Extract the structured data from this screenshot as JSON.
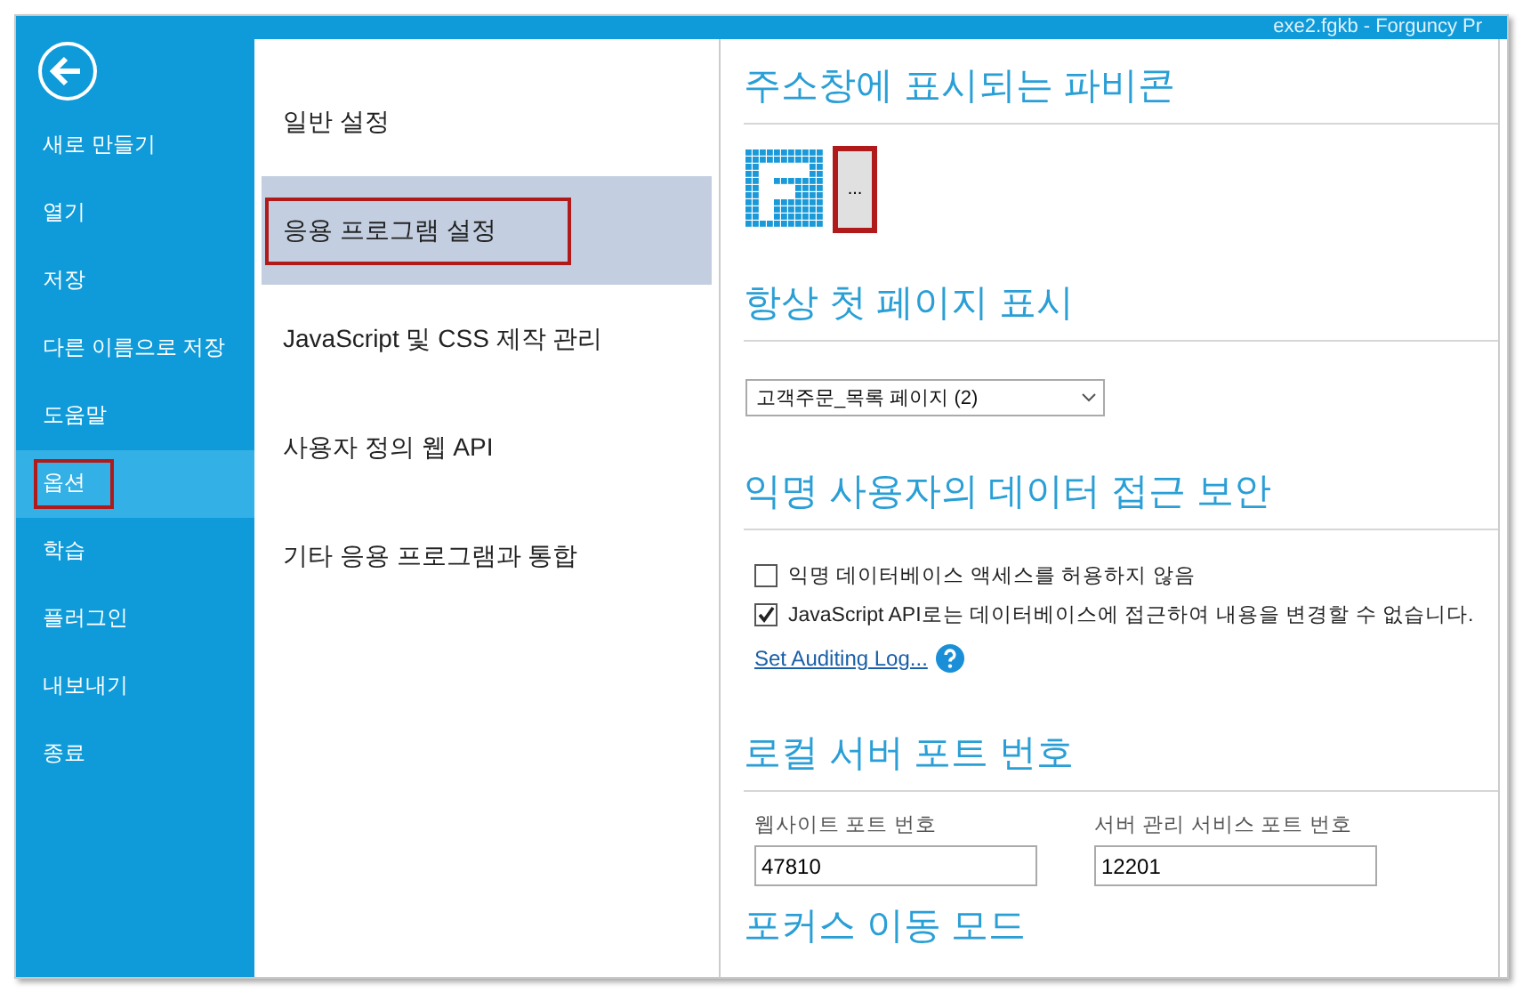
{
  "window": {
    "title": "exe2.fgkb - Forguncy Pr"
  },
  "sidebar": {
    "items": [
      {
        "label": "새로 만들기",
        "selected": false,
        "highlighted": false
      },
      {
        "label": "열기",
        "selected": false,
        "highlighted": false
      },
      {
        "label": "저장",
        "selected": false,
        "highlighted": false
      },
      {
        "label": "다른 이름으로 저장",
        "selected": false,
        "highlighted": false
      },
      {
        "label": "도움말",
        "selected": false,
        "highlighted": false
      },
      {
        "label": "옵션",
        "selected": true,
        "highlighted": true
      },
      {
        "label": "학습",
        "selected": false,
        "highlighted": false
      },
      {
        "label": "플러그인",
        "selected": false,
        "highlighted": false
      },
      {
        "label": "내보내기",
        "selected": false,
        "highlighted": false
      },
      {
        "label": "종료",
        "selected": false,
        "highlighted": false
      }
    ]
  },
  "categories": [
    {
      "label": "일반 설정",
      "selected": false,
      "highlighted": false
    },
    {
      "label": "응용 프로그램 설정",
      "selected": true,
      "highlighted": true
    },
    {
      "label": "JavaScript 및 CSS 제작 관리",
      "selected": false,
      "highlighted": false
    },
    {
      "label": "사용자 정의 웹 API",
      "selected": false,
      "highlighted": false
    },
    {
      "label": "기타 응용 프로그램과 통합",
      "selected": false,
      "highlighted": false
    }
  ],
  "sections": [
    {
      "kind": "favicon",
      "heading": "주소창에 표시되는 파비콘",
      "browse_button": {
        "label": "...",
        "highlighted": true
      }
    },
    {
      "kind": "dropdown",
      "heading": "항상 첫 페이지 표시",
      "value": "고객주문_목록 페이지 (2)"
    },
    {
      "kind": "checks",
      "heading": "익명 사용자의 데이터 접근 보안",
      "options": [
        {
          "label": "익명 데이터베이스 액세스를 허용하지 않음",
          "checked": false
        },
        {
          "label": "JavaScript API로는 데이터베이스에 접근하여 내용을 변경할 수 없습니다.",
          "checked": true
        }
      ],
      "link": "Set Auditing Log..."
    },
    {
      "kind": "ports",
      "heading": "로컬 서버 포트 번호",
      "fields": [
        {
          "label": "웹사이트 포트 번호",
          "value": "47810"
        },
        {
          "label": "서버 관리 서비스 포트 번호",
          "value": "12201"
        }
      ]
    },
    {
      "kind": "heading",
      "heading": "포커스 이동 모드"
    }
  ]
}
